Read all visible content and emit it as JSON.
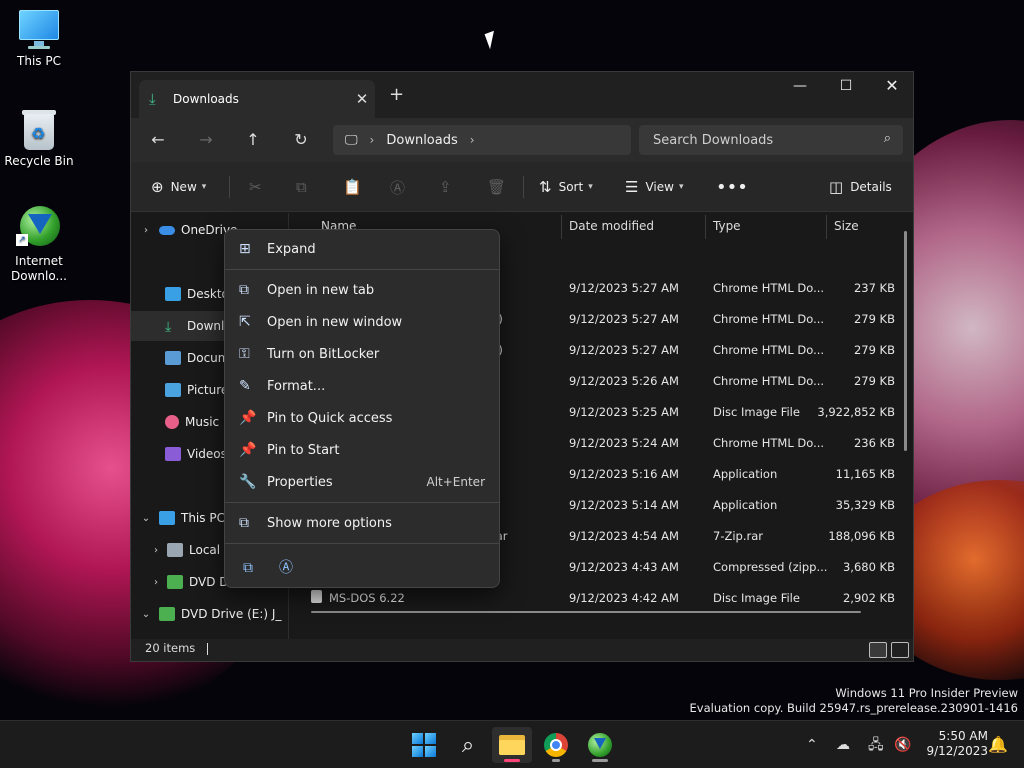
{
  "desktop": {
    "icons": [
      {
        "label": "This PC"
      },
      {
        "label": "Recycle Bin"
      },
      {
        "label": "Internet Downlo..."
      }
    ]
  },
  "explorer": {
    "tab_title": "Downloads",
    "address": {
      "segment": "Downloads"
    },
    "search": {
      "placeholder": "Search Downloads"
    },
    "toolbar": {
      "new_label": "New",
      "sort_label": "Sort",
      "view_label": "View",
      "details_label": "Details"
    },
    "nav": {
      "onedrive": "OneDrive",
      "desktop": "Desktop",
      "downloads": "Downloads",
      "documents": "Documents",
      "pictures": "Pictures",
      "music": "Music",
      "videos": "Videos",
      "this_pc": "This PC",
      "local_disk": "Local Disk (C:)",
      "dvd_d": "DVD Drive (D:)",
      "dvd_e": "DVD Drive (E:) J_"
    },
    "columns": {
      "name": "Name",
      "date": "Date modified",
      "type": "Type",
      "size": "Size"
    },
    "rows": [
      {
        "name": "",
        "date": "9/12/2023 5:27 AM",
        "type": "Chrome HTML Do...",
        "size": "237 KB"
      },
      {
        "name": "2)",
        "date": "9/12/2023 5:27 AM",
        "type": "Chrome HTML Do...",
        "size": "279 KB"
      },
      {
        "name": "1)",
        "date": "9/12/2023 5:27 AM",
        "type": "Chrome HTML Do...",
        "size": "279 KB"
      },
      {
        "name": "",
        "date": "9/12/2023 5:26 AM",
        "type": "Chrome HTML Do...",
        "size": "279 KB"
      },
      {
        "name": "",
        "date": "9/12/2023 5:25 AM",
        "type": "Disc Image File",
        "size": "3,922,852 KB"
      },
      {
        "name": "",
        "date": "9/12/2023 5:24 AM",
        "type": "Chrome HTML Do...",
        "size": "236 KB"
      },
      {
        "name": "",
        "date": "9/12/2023 5:16 AM",
        "type": "Application",
        "size": "11,165 KB"
      },
      {
        "name": "",
        "date": "9/12/2023 5:14 AM",
        "type": "Application",
        "size": "35,329 KB"
      },
      {
        "name": "rar",
        "date": "9/12/2023 4:54 AM",
        "type": "7-Zip.rar",
        "size": "188,096 KB"
      },
      {
        "name": "",
        "date": "9/12/2023 4:43 AM",
        "type": "Compressed (zipp...",
        "size": "3,680 KB"
      },
      {
        "name": "MS-DOS 6.22",
        "date": "9/12/2023 4:42 AM",
        "type": "Disc Image File",
        "size": "2,902 KB"
      }
    ],
    "status": {
      "count": "20 items"
    }
  },
  "context_menu": {
    "expand": "Expand",
    "open_new_tab": "Open in new tab",
    "open_new_window": "Open in new window",
    "bitlocker": "Turn on BitLocker",
    "format": "Format...",
    "pin_quick": "Pin to Quick access",
    "pin_start": "Pin to Start",
    "properties": "Properties",
    "properties_shortcut": "Alt+Enter",
    "more_options": "Show more options"
  },
  "watermark": {
    "line1": "Windows 11 Pro Insider Preview",
    "line2": "Evaluation copy. Build 25947.rs_prerelease.230901-1416"
  },
  "taskbar": {
    "time": "5:50 AM",
    "date": "9/12/2023"
  }
}
